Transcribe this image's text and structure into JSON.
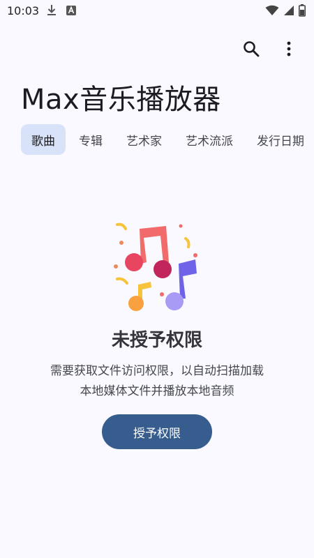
{
  "status_bar": {
    "time": "10:03",
    "left_icons": [
      "download-icon",
      "font-a-icon"
    ],
    "right_icons": [
      "wifi-icon",
      "cellular-icon",
      "battery-icon"
    ]
  },
  "header": {
    "app_title": "Max音乐播放器",
    "actions": [
      "search-icon",
      "more-vert-icon"
    ]
  },
  "tabs": [
    {
      "label": "歌曲",
      "active": true
    },
    {
      "label": "专辑",
      "active": false
    },
    {
      "label": "艺术家",
      "active": false
    },
    {
      "label": "艺术流派",
      "active": false
    },
    {
      "label": "发行日期",
      "active": false
    }
  ],
  "empty_state": {
    "illustration": "music-notes-icon",
    "title": "未授予权限",
    "description_line1": "需要获取文件访问权限，以自动扫描加载",
    "description_line2": "本地媒体文件并播放本地音频",
    "button_label": "授予权限"
  },
  "colors": {
    "background": "#f9f9ff",
    "tab_active_bg": "#d8e2f9",
    "button_bg": "#365d8d",
    "button_text": "#ffffff"
  }
}
